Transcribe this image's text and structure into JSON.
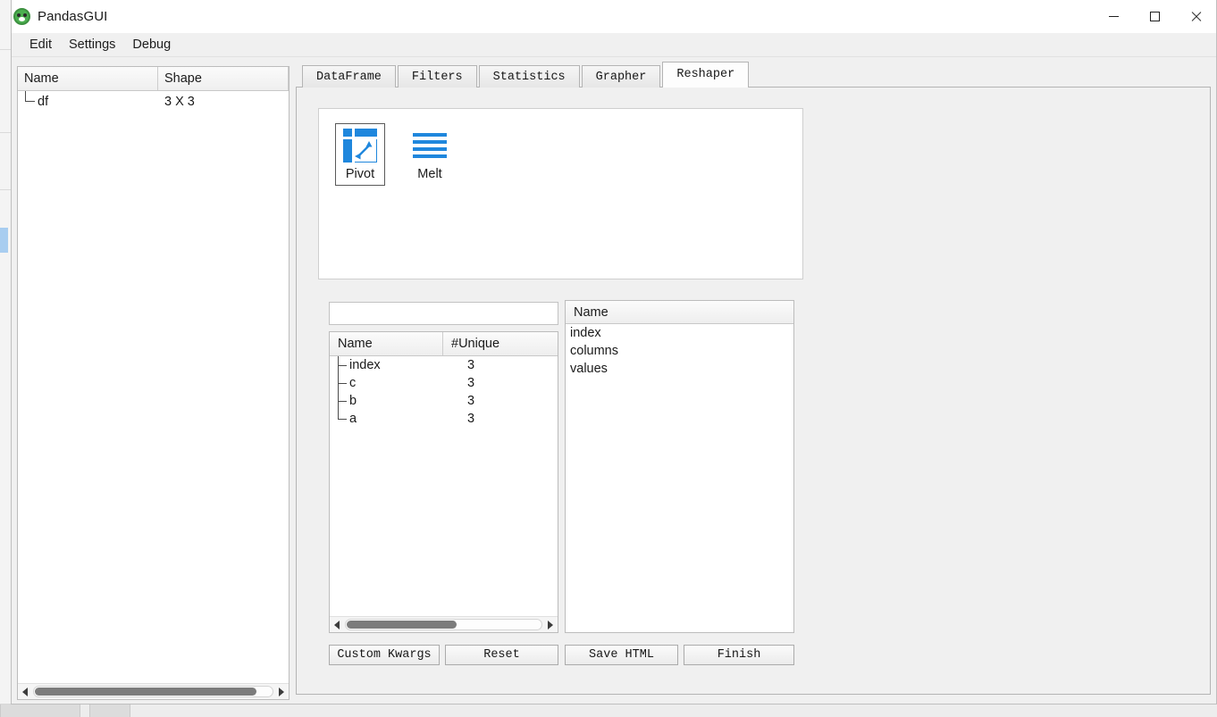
{
  "window": {
    "title": "PandasGUI",
    "icon": "panda-logo-icon",
    "controls": {
      "minimize": "minimize-icon",
      "maximize": "maximize-icon",
      "close": "close-icon"
    }
  },
  "menubar": {
    "items": [
      {
        "label": "Edit"
      },
      {
        "label": "Settings"
      },
      {
        "label": "Debug"
      }
    ]
  },
  "dataframe_explorer": {
    "columns": [
      "Name",
      "Shape"
    ],
    "rows": [
      {
        "name": "df",
        "shape": "3 X 3"
      }
    ],
    "hscroll": {
      "thumb_percent": 93
    }
  },
  "tabs": [
    {
      "label": "DataFrame",
      "active": false
    },
    {
      "label": "Filters",
      "active": false
    },
    {
      "label": "Statistics",
      "active": false
    },
    {
      "label": "Grapher",
      "active": false
    },
    {
      "label": "Reshaper",
      "active": true
    }
  ],
  "reshaper": {
    "reshape_types": [
      {
        "label": "Pivot",
        "icon": "pivot-icon",
        "selected": true
      },
      {
        "label": "Melt",
        "icon": "melt-icon",
        "selected": false
      }
    ],
    "search": {
      "value": "",
      "placeholder": ""
    },
    "source_tree": {
      "columns": [
        "Name",
        "#Unique"
      ],
      "sort_column": "Name",
      "rows": [
        {
          "name": "index",
          "unique": "3"
        },
        {
          "name": "c",
          "unique": "3"
        },
        {
          "name": "b",
          "unique": "3"
        },
        {
          "name": "a",
          "unique": "3"
        }
      ],
      "hscroll": {
        "thumb_percent": 56
      }
    },
    "dest_list": {
      "header": "Name",
      "items": [
        "index",
        "columns",
        "values"
      ]
    },
    "buttons": {
      "custom_kwargs": "Custom Kwargs",
      "reset": "Reset",
      "save_html": "Save HTML",
      "finish": "Finish"
    }
  },
  "colors": {
    "accent_blue": "#1f87dd",
    "window_bg": "#f0f0f0",
    "panel_white": "#ffffff",
    "logo_green": "#4caf50"
  }
}
